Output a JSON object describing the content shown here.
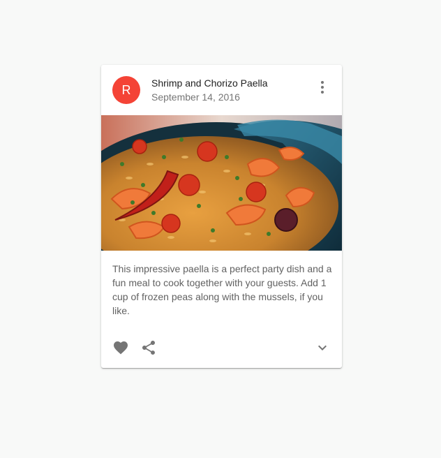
{
  "card": {
    "avatar_letter": "R",
    "title": "Shrimp and Chorizo Paella",
    "subheader": "September 14, 2016",
    "description": "This impressive paella is a perfect party dish and a fun meal to cook together with your guests. Add 1 cup of frozen peas along with the mussels, if you like.",
    "more_icon": "more-vert-icon",
    "media_alt": "Paella dish",
    "actions": {
      "favorite_icon": "favorite-icon",
      "share_icon": "share-icon",
      "expand_icon": "expand-more-icon"
    }
  },
  "colors": {
    "avatar_bg": "#f44336",
    "icon": "#757575",
    "background": "#f8f9f8"
  }
}
